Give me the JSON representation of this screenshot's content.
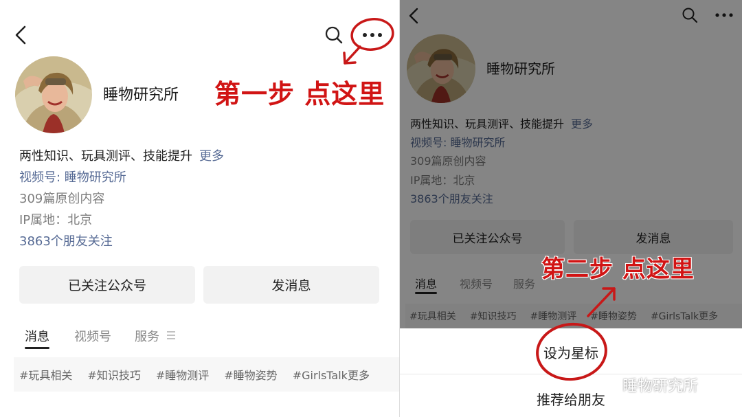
{
  "colors": {
    "link": "#576b95",
    "annotation": "#d11414",
    "button_bg": "#f2f2f2",
    "overlay": "rgba(0,0,0,0.48)"
  },
  "left": {
    "header": {
      "back_icon": "chevron-left-icon",
      "search_icon": "search-icon",
      "more_icon": "more-dots-icon"
    },
    "account": {
      "name": "睡物研究所",
      "description": "两性知识、玩具测评、技能提升",
      "more_label": "更多",
      "channel_label": "视频号: 睡物研究所",
      "original_count": "309篇原创内容",
      "ip_location": "IP属地：北京",
      "friends_following": "3863个朋友关注"
    },
    "buttons": {
      "followed": "已关注公众号",
      "message": "发消息"
    },
    "tabs": [
      {
        "label": "消息"
      },
      {
        "label": "视频号"
      },
      {
        "label": "服务"
      }
    ],
    "menu_icon": "hamburger-icon",
    "tags": [
      "#玩具相关",
      "#知识技巧",
      "#睡物测评",
      "#睡物姿势",
      "#GirlsTalk更多"
    ],
    "annotation": "第一步 点这里"
  },
  "right": {
    "header": {
      "back_icon": "chevron-left-icon",
      "search_icon": "search-icon",
      "more_icon": "more-dots-icon"
    },
    "account": {
      "name": "睡物研究所",
      "description": "两性知识、玩具测评、技能提升",
      "more_label": "更多",
      "channel_label": "视频号: 睡物研究所",
      "original_count": "309篇原创内容",
      "ip_location": "IP属地：北京",
      "friends_following": "3863个朋友关注"
    },
    "buttons": {
      "followed": "已关注公众号",
      "message": "发消息"
    },
    "tabs": [
      {
        "label": "消息"
      },
      {
        "label": "视频号"
      },
      {
        "label": "服务"
      }
    ],
    "tags": [
      "#玩具相关",
      "#知识技巧",
      "#睡物测评",
      "#睡物姿势",
      "#GirlsTalk更多"
    ],
    "annotation": "第二步 点这里",
    "sheet": {
      "set_star": "设为星标",
      "recommend": "推荐给朋友"
    },
    "watermark": "睡物研究所",
    "watermark_icon": "wechat-logo-icon"
  }
}
